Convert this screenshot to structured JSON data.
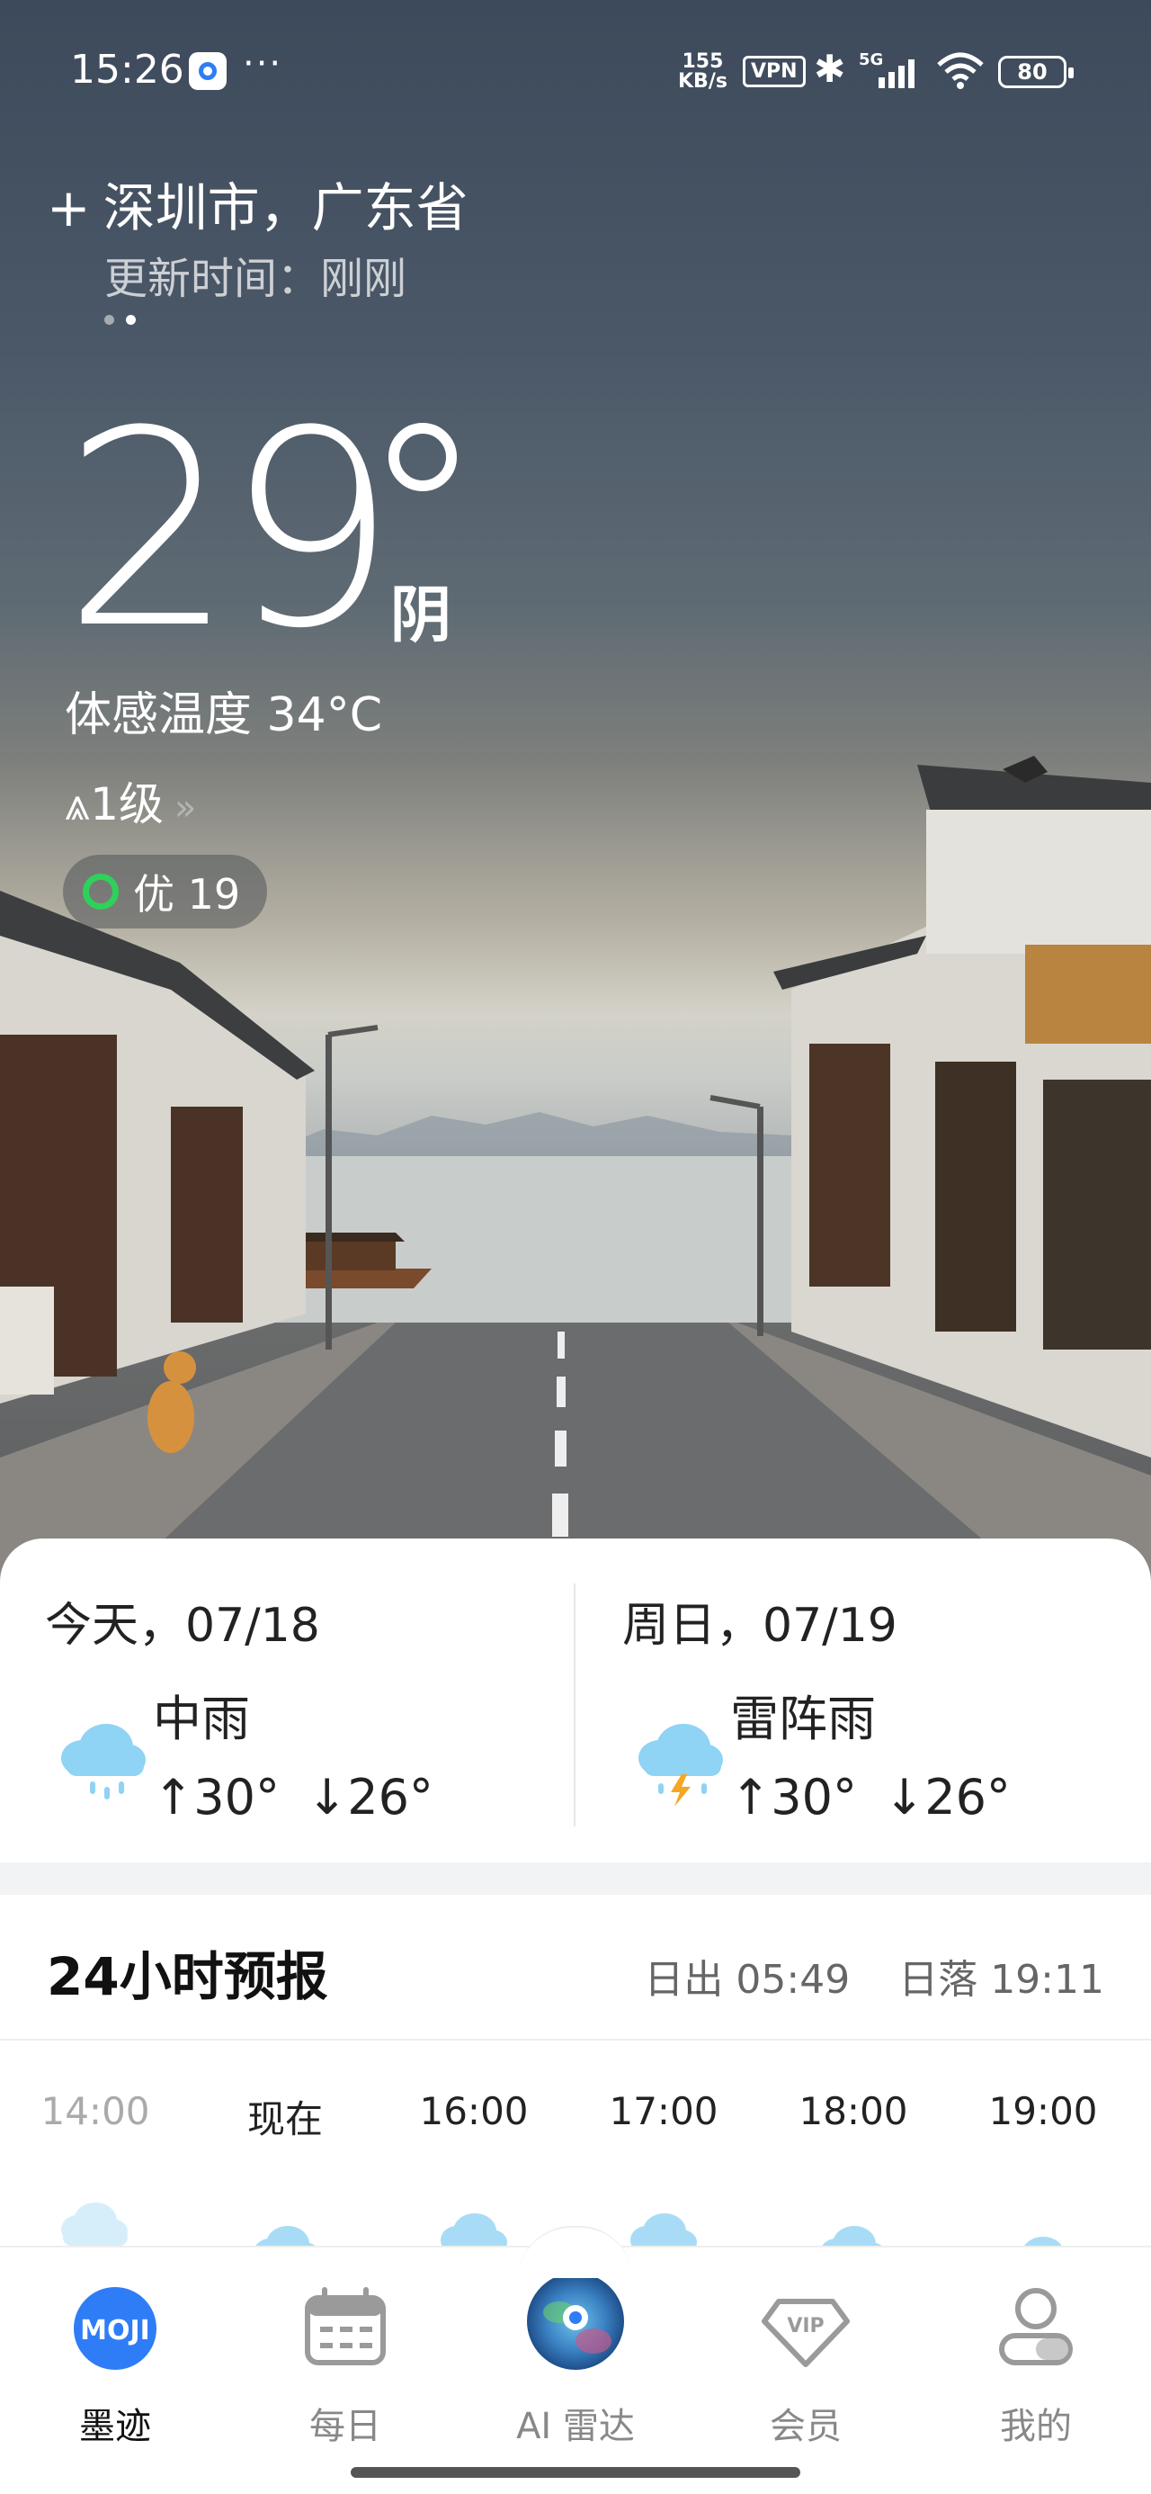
{
  "status_bar": {
    "time": "15:26",
    "more": "···",
    "net_speed_value": "155",
    "net_speed_unit": "KB/s",
    "vpn": "VPN",
    "network": "5G",
    "battery": "80"
  },
  "location": {
    "city": "深圳市，广东省",
    "updated": "更新时间：刚刚",
    "page_count": 2,
    "active_page": 1
  },
  "current": {
    "temperature": "29",
    "condition": "阴",
    "feels_like": "体感温度 34°C",
    "wind": "1级",
    "aqi_label": "优 19",
    "aqi_color": "#2ed15a"
  },
  "daily": [
    {
      "date": "今天，07/18",
      "condition": "中雨",
      "high": "↑30°",
      "low": "↓26°",
      "icon": "rain-cloud-icon"
    },
    {
      "date": "周日，07/19",
      "condition": "雷阵雨",
      "high": "↑30°",
      "low": "↓26°",
      "icon": "thunder-rain-cloud-icon"
    }
  ],
  "hourly": {
    "title": "24小时预报",
    "sunrise": "日出 05:49",
    "sunset": "日落 19:11",
    "hours": [
      "14:00",
      "现在",
      "16:00",
      "17:00",
      "18:00",
      "19:00"
    ]
  },
  "nav": {
    "items": [
      {
        "label": "墨迹",
        "icon": "moji-logo-icon"
      },
      {
        "label": "每日",
        "icon": "calendar-icon"
      },
      {
        "label": "AI 雷达",
        "icon": "radar-globe-icon"
      },
      {
        "label": "会员",
        "icon": "vip-diamond-icon"
      },
      {
        "label": "我的",
        "icon": "profile-icon"
      }
    ],
    "active_index": 0
  },
  "colors": {
    "accent": "#2f7df6",
    "rain_icon": "#8fd3f5",
    "lightning": "#f5a623"
  }
}
